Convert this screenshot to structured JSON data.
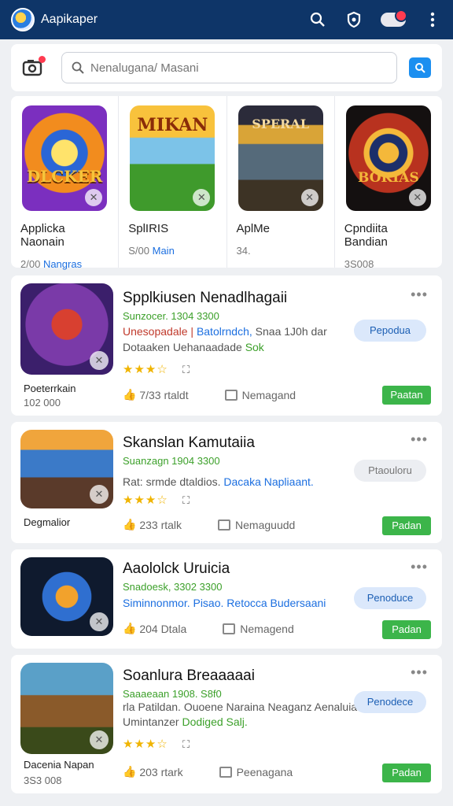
{
  "header": {
    "title": "Aapikaper"
  },
  "search": {
    "placeholder": "Nenalugana/ Masani"
  },
  "featured": [
    {
      "art_text": "DLCKER",
      "name": "Applicka Naonain",
      "meta_a": "2/00",
      "meta_b": "Nangras"
    },
    {
      "art_text": "MIKAN",
      "name": "SplIRIS",
      "meta_a": "S/00",
      "meta_b": "Main"
    },
    {
      "art_text": "SPERAL",
      "name": "AplMe",
      "meta_a": "34.",
      "meta_b": ""
    },
    {
      "art_text": "BOKIAS",
      "name": "Cpndiita Bandian",
      "meta_a": "3S008",
      "meta_b": ""
    }
  ],
  "apps": [
    {
      "title": "Spplkiusen Nenadlhagaii",
      "sub": "Sunzocer. 1304 3300",
      "desc1_a": "Unesopadale |",
      "desc1_b": "Batolrndch,",
      "desc1_c": "Snaa 1J0h dar",
      "desc2_a": "Dotaaken Uehanaadade",
      "desc2_b": "Sok",
      "rating": "★★★☆",
      "stat1": "7/33 rtaldt",
      "stat2": "Nemagand",
      "pill": "Pepodua",
      "get": "Paatan",
      "dev": "Poeterrkain",
      "dev_sub": "102 000"
    },
    {
      "title": "Skanslan Kamutaiia",
      "sub": "Suanzagn 1904 3300",
      "desc1_a": "Rat: srmde dtaldios.",
      "desc1_b": "Dacaka Napliaant.",
      "rating": "★★★☆",
      "stat1": "233 rtalk",
      "stat2": "Nemaguudd",
      "pill": "Ptaouloru",
      "get": "Padan",
      "dev": "Degmalior",
      "dev_sub": ""
    },
    {
      "title": "Aaololck Uruicia",
      "sub": "Snadoesk, 3302 3300",
      "desc1_a": "Siminnonmor. Pisao.",
      "desc1_b": "Retocca Budersaani",
      "stat1": "204 Dtala",
      "stat2": "Nemagend",
      "pill": "Penoduce",
      "get": "Padan"
    },
    {
      "title": "Soanlura Breaaaaai",
      "sub": "Saaaeaan 1908. S8f0",
      "desc1_a": "rla Patildan. Ouoene Naraina Neaganz Aenaluia",
      "desc2_a": "Umintanzer",
      "desc2_b": "Dodiged Salj.",
      "rating": "★★★☆",
      "stat1": "203 rtark",
      "stat2": "Peenagana",
      "pill": "Penodece",
      "get": "Padan",
      "dev": "Dacenia Napan",
      "dev_sub": "3S3 008"
    }
  ]
}
